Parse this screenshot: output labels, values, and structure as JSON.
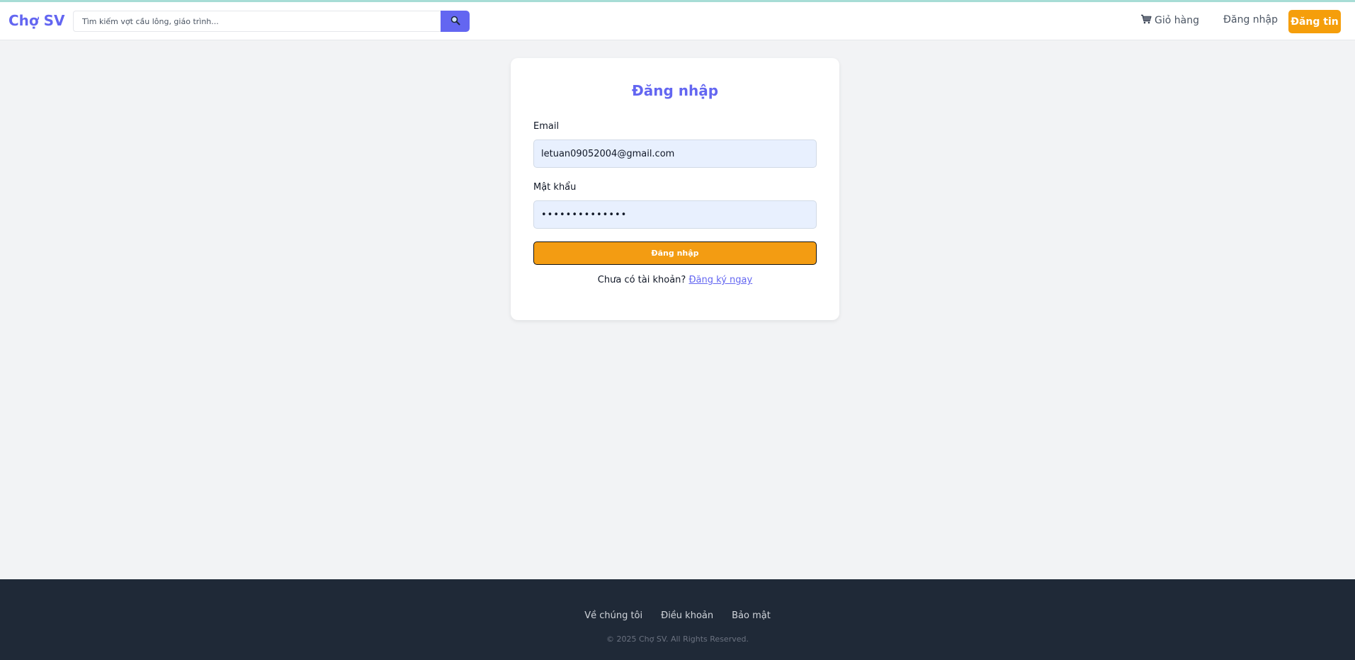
{
  "header": {
    "logo": "Chợ SV",
    "search": {
      "placeholder": "Tìm kiếm vợt cầu lông, giáo trình..."
    },
    "cart_label": "Giỏ hàng",
    "login_label": "Đăng nhập",
    "post_label": "Đăng tin"
  },
  "login_form": {
    "title": "Đăng nhập",
    "email_label": "Email",
    "email_value": "letuan09052004@gmail.com",
    "password_label": "Mật khẩu",
    "password_value": "••••••••••••••",
    "submit_label": "Đăng nhập",
    "no_account_text": "Chưa có tài khoản?",
    "signup_link": "Đăng ký ngay"
  },
  "footer": {
    "links": [
      "Về chúng tôi",
      "Điều khoản",
      "Bảo mật"
    ],
    "copyright": "© 2025 Chợ SV. All Rights Reserved."
  },
  "colors": {
    "brand": "#6366f1",
    "accent": "#f59e0b",
    "footer_bg": "#1f2937",
    "page_bg": "#f2f3f5"
  },
  "icons": {
    "search": "search-icon",
    "cart": "cart-icon"
  }
}
